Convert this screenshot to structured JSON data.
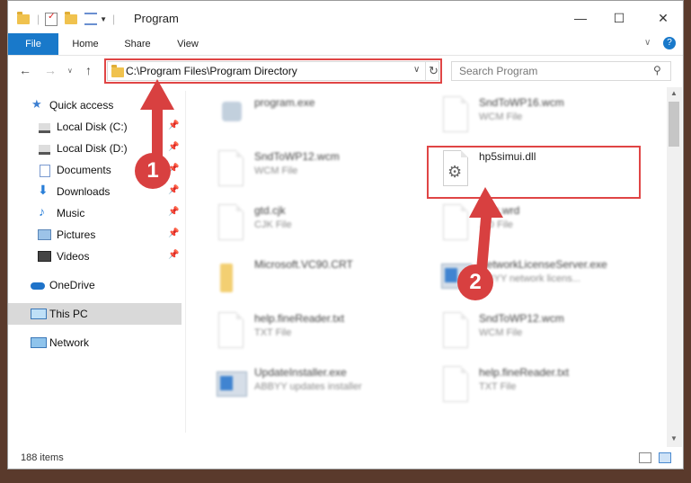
{
  "window": {
    "title": "Program",
    "controls": {
      "minimize": "—",
      "maximize": "☐",
      "close": "✕"
    }
  },
  "ribbon": {
    "tabs": [
      "File",
      "Home",
      "Share",
      "View"
    ]
  },
  "address": {
    "path": "C:\\Program Files\\Program Directory",
    "search_placeholder": "Search Program"
  },
  "sidebar": {
    "items": [
      {
        "label": "Quick access",
        "icon": "star-icon"
      },
      {
        "label": "Local Disk (C:)",
        "icon": "drive-icon"
      },
      {
        "label": "Local Disk (D:)",
        "icon": "drive-icon"
      },
      {
        "label": "Documents",
        "icon": "documents-icon"
      },
      {
        "label": "Downloads",
        "icon": "download-icon"
      },
      {
        "label": "Music",
        "icon": "music-icon"
      },
      {
        "label": "Pictures",
        "icon": "pictures-icon"
      },
      {
        "label": "Videos",
        "icon": "videos-icon"
      },
      {
        "label": "OneDrive",
        "icon": "cloud-icon"
      },
      {
        "label": "This PC",
        "icon": "computer-icon"
      },
      {
        "label": "Network",
        "icon": "network-icon"
      }
    ]
  },
  "files": [
    {
      "name": "program.exe",
      "sub": ""
    },
    {
      "name": "SndToWP16.wcm",
      "sub": "WCM File"
    },
    {
      "name": "SndToWP12.wcm",
      "sub": "WCM File"
    },
    {
      "name": "hp5simui.dll",
      "sub": ""
    },
    {
      "name": "gtd.cjk",
      "sub": "CJK File"
    },
    {
      "name": "...oc.wrd",
      "sub": "...D File"
    },
    {
      "name": "Microsoft.VC90.CRT",
      "sub": ""
    },
    {
      "name": "NetworkLicenseServer.exe",
      "sub": "...BYY network licens..."
    },
    {
      "name": "help.fineReader.txt",
      "sub": "TXT File"
    },
    {
      "name": "SndToWP12.wcm",
      "sub": "WCM File"
    },
    {
      "name": "UpdateInstaller.exe",
      "sub": "ABBYY updates installer"
    },
    {
      "name": "help.fineReader.txt",
      "sub": "TXT File"
    }
  ],
  "status": {
    "count": "188 items"
  },
  "callouts": {
    "one": "1",
    "two": "2"
  },
  "colors": {
    "accent": "#1979ca",
    "highlight": "#e04545"
  }
}
